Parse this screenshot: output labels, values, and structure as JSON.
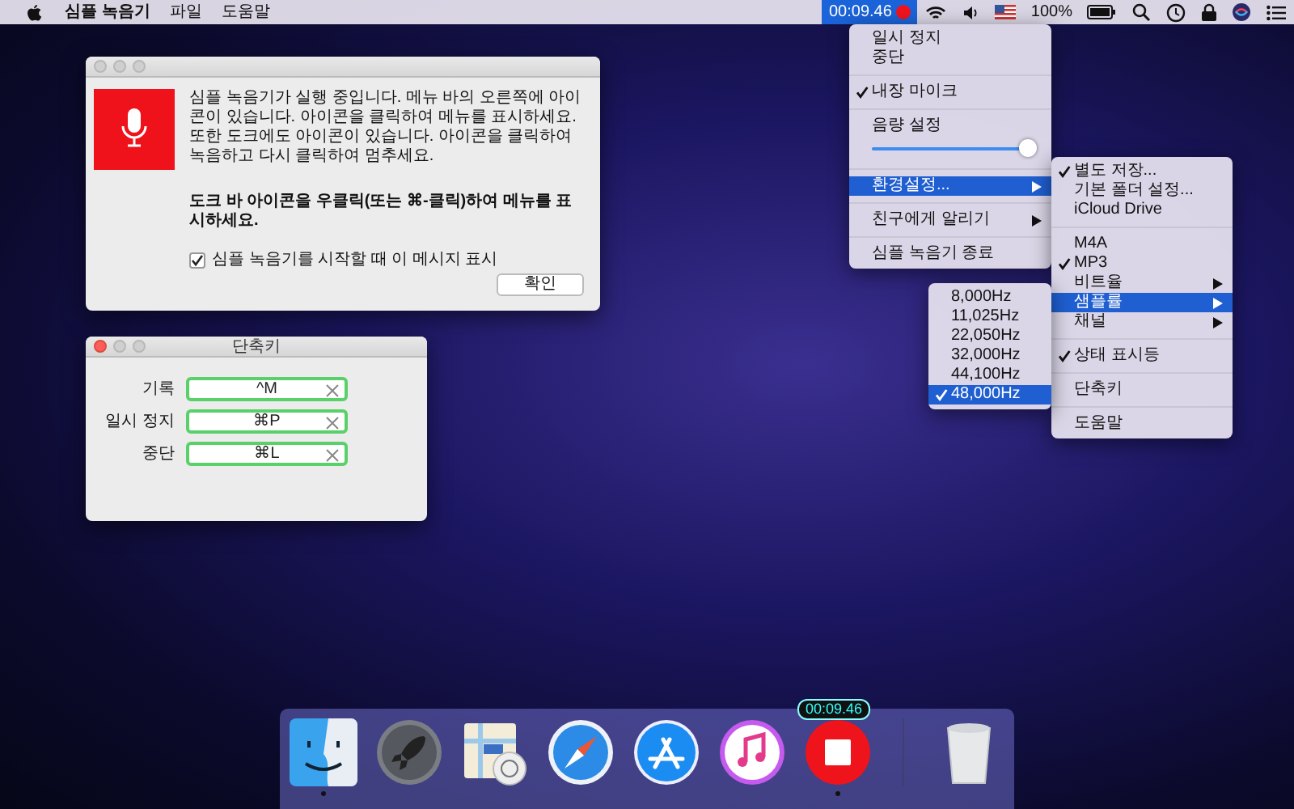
{
  "menu_bar": {
    "app_name": "심플 녹음기",
    "menus": [
      "파일",
      "도움말"
    ],
    "timer": {
      "text": "00:09.46",
      "selected": true,
      "recording": true
    },
    "battery": "100%"
  },
  "welcome_window": {
    "active": false,
    "message": "심플 녹음기가 실행 중입니다. 메뉴 바의 오른쪽에 아이콘이 있습니다. 아이콘을 클릭하여 메뉴를 표시하세요. 또한 도크에도 아이콘이 있습니다. 아이콘을 클릭하여 녹음하고 다시 클릭하여 멈추세요.",
    "hint": "도크 바 아이콘을 우클릭(또는 ⌘-클릭)하여 메뉴를 표시하세요.",
    "checkbox": {
      "label": "심플 녹음기를 시작할 때 이 메시지 표시",
      "checked": true
    },
    "button": "확인"
  },
  "shortcut_window": {
    "title": "단축키",
    "active": true,
    "rows": [
      {
        "label": "기록",
        "value": "^M"
      },
      {
        "label": "일시 정지",
        "value": "⌘P"
      },
      {
        "label": "중단",
        "value": "⌘L"
      }
    ]
  },
  "status_menu": {
    "items": [
      {
        "kind": "item",
        "label": "일시 정지",
        "checked": false,
        "selected": false,
        "submenu": false
      },
      {
        "kind": "item",
        "label": "중단",
        "checked": false,
        "selected": false,
        "submenu": false
      },
      {
        "kind": "separator"
      },
      {
        "kind": "item",
        "label": "내장 마이크",
        "checked": true,
        "selected": false,
        "submenu": false
      },
      {
        "kind": "separator"
      },
      {
        "kind": "item",
        "label": "음량 설정",
        "checked": false,
        "selected": false,
        "submenu": false
      },
      {
        "kind": "slider",
        "level": 0.95
      },
      {
        "kind": "separator"
      },
      {
        "kind": "item",
        "label": "환경설정...",
        "checked": false,
        "selected": true,
        "submenu": true
      },
      {
        "kind": "separator"
      },
      {
        "kind": "item",
        "label": "친구에게 알리기",
        "checked": false,
        "selected": false,
        "submenu": true
      },
      {
        "kind": "separator"
      },
      {
        "kind": "item",
        "label": "심플 녹음기 종료",
        "checked": false,
        "selected": false,
        "submenu": false
      }
    ]
  },
  "settings_submenu": {
    "items": [
      {
        "kind": "item",
        "label": "별도 저장...",
        "checked": true,
        "selected": false,
        "submenu": false
      },
      {
        "kind": "item",
        "label": "기본 폴더 설정...",
        "checked": false,
        "selected": false,
        "submenu": false
      },
      {
        "kind": "item",
        "label": "iCloud Drive",
        "checked": false,
        "selected": false,
        "submenu": false
      },
      {
        "kind": "separator"
      },
      {
        "kind": "item",
        "label": "M4A",
        "checked": false,
        "selected": false,
        "submenu": false
      },
      {
        "kind": "item",
        "label": "MP3",
        "checked": true,
        "selected": false,
        "submenu": false
      },
      {
        "kind": "item",
        "label": "비트율",
        "checked": false,
        "selected": false,
        "submenu": true
      },
      {
        "kind": "item",
        "label": "샘플률",
        "checked": false,
        "selected": true,
        "submenu": true
      },
      {
        "kind": "item",
        "label": "채널",
        "checked": false,
        "selected": false,
        "submenu": true
      },
      {
        "kind": "separator"
      },
      {
        "kind": "item",
        "label": "상태 표시등",
        "checked": true,
        "selected": false,
        "submenu": false
      },
      {
        "kind": "separator"
      },
      {
        "kind": "item",
        "label": "단축키",
        "checked": false,
        "selected": false,
        "submenu": false
      },
      {
        "kind": "separator"
      },
      {
        "kind": "item",
        "label": "도움말",
        "checked": false,
        "selected": false,
        "submenu": false
      }
    ]
  },
  "sample_rate_submenu": {
    "items": [
      {
        "kind": "item",
        "label": "8,000Hz",
        "checked": false,
        "selected": false,
        "submenu": false
      },
      {
        "kind": "item",
        "label": "11,025Hz",
        "checked": false,
        "selected": false,
        "submenu": false
      },
      {
        "kind": "item",
        "label": "22,050Hz",
        "checked": false,
        "selected": false,
        "submenu": false
      },
      {
        "kind": "item",
        "label": "32,000Hz",
        "checked": false,
        "selected": false,
        "submenu": false
      },
      {
        "kind": "item",
        "label": "44,100Hz",
        "checked": false,
        "selected": false,
        "submenu": false
      },
      {
        "kind": "item",
        "label": "48,000Hz",
        "checked": true,
        "selected": true,
        "submenu": false
      }
    ]
  },
  "dock": {
    "items": [
      {
        "kind": "face",
        "running": true
      },
      {
        "kind": "rocket",
        "running": false
      },
      {
        "kind": "map",
        "running": false
      },
      {
        "kind": "compass",
        "running": false
      },
      {
        "kind": "store",
        "running": false
      },
      {
        "kind": "music",
        "running": false
      },
      {
        "kind": "recorder",
        "running": true,
        "badge": "00:09.46"
      },
      {
        "kind": "trash",
        "running": false
      }
    ]
  }
}
